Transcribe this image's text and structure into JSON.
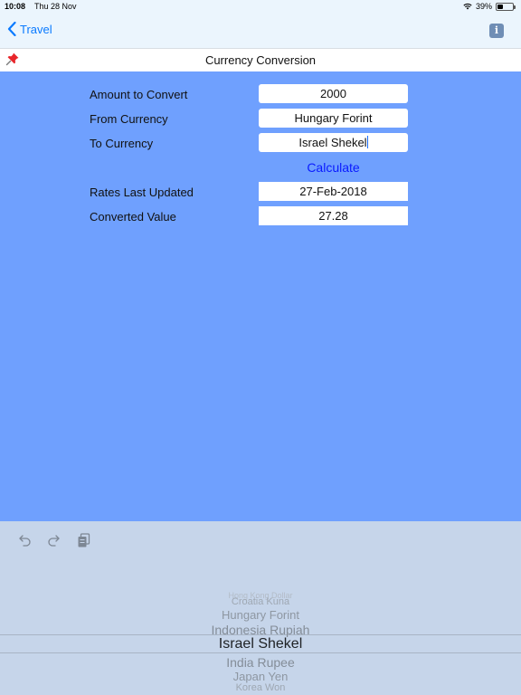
{
  "status": {
    "time": "10:08",
    "date": "Thu 28 Nov",
    "battery": "39%",
    "battery_level": 0.39
  },
  "nav": {
    "back_label": "Travel",
    "info_label": "i"
  },
  "title": "Currency Conversion",
  "form": {
    "amount_label": "Amount to Convert",
    "amount_value": "2000",
    "from_label": "From Currency",
    "from_value": "Hungary Forint",
    "to_label": "To Currency",
    "to_value": "Israel Shekel",
    "calculate_label": "Calculate",
    "updated_label": "Rates Last Updated",
    "updated_value": "27-Feb-2018",
    "converted_label": "Converted Value",
    "converted_value": "27.28"
  },
  "picker": {
    "items": [
      "Hong Kong Dollar",
      "Croatia Kuna",
      "Hungary Forint",
      "Indonesia Rupiah",
      "Israel Shekel",
      "India Rupee",
      "Japan Yen",
      "Korea Won"
    ],
    "selected": "Israel Shekel"
  },
  "colors": {
    "accent": "#0a7aff",
    "background": "#6fa0fe",
    "calculate": "#0a1aff"
  },
  "icons": {
    "undo": "undo-icon",
    "redo": "redo-icon",
    "paste": "paste-icon",
    "pin": "pin-icon",
    "info": "info-icon"
  }
}
